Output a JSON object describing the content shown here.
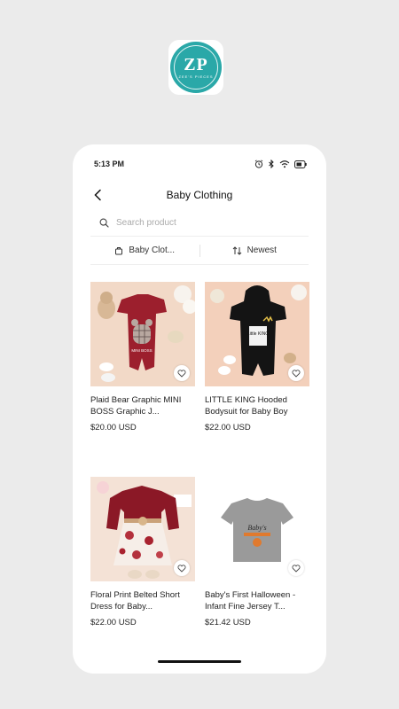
{
  "logo": {
    "mark": "ZP",
    "tagline": "ZEE'S PIECES"
  },
  "status_bar": {
    "time": "5:13 PM",
    "icons": [
      "alarm-icon",
      "bluetooth-icon",
      "wifi-icon",
      "battery-icon"
    ]
  },
  "header": {
    "title": "Baby Clothing",
    "back_icon": "chevron-left-icon"
  },
  "search": {
    "placeholder": "Search product",
    "value": ""
  },
  "filters": {
    "category_label": "Baby Clot...",
    "sort_label": "Newest"
  },
  "products": [
    {
      "title": "Plaid Bear Graphic MINI BOSS Graphic J...",
      "price": "$20.00 USD",
      "image_text": "MINI BOSS"
    },
    {
      "title": "LITTLE KING Hooded Bodysuit for Baby Boy",
      "price": "$22.00 USD",
      "image_text": "Little KING"
    },
    {
      "title": "Floral Print Belted Short Dress for Baby...",
      "price": "$22.00 USD"
    },
    {
      "title": "Baby's First Halloween - Infant Fine Jersey T...",
      "price": "$21.42 USD",
      "image_text": "Baby's"
    }
  ],
  "colors": {
    "brand": "#2aa8a8",
    "background": "#ebebeb",
    "card": "#ffffff"
  }
}
